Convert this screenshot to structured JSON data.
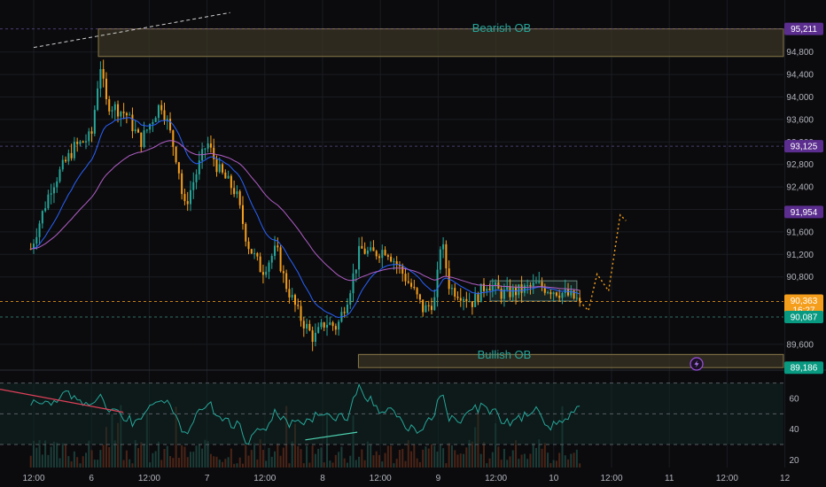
{
  "colors": {
    "background": "#0b0b0d",
    "grid": "#1a1c22",
    "up": "#26a69a",
    "down": "#f59e1c",
    "ma_fast": "#2962ff",
    "ma_slow": "#b05ec7",
    "ob_fill": "#3a3424",
    "ob_border": "#8a7a4a",
    "ob_text": "#26a69a",
    "tag_purple": "#5b2d8e",
    "tag_orange": "#f59e1c",
    "tag_green": "#089981",
    "rsi_line": "#26a69a",
    "volume": "#1f4a44"
  },
  "chart_data": [
    {
      "type": "candlestick",
      "ylim": [
        89000,
        95500
      ],
      "y_ticks": [
        "94,800",
        "94,400",
        "94,000",
        "93,600",
        "93,200",
        "92,800",
        "92,400",
        "92,000",
        "91,600",
        "91,200",
        "90,800",
        "89,600"
      ],
      "x_ticks": [
        "12:00",
        "6",
        "12:00",
        "7",
        "12:00",
        "8",
        "12:00",
        "9",
        "12:00",
        "10",
        "12:00",
        "11",
        "12:00",
        "12"
      ],
      "x_domain": [
        0,
        14
      ],
      "close_path": [
        [
          -0.05,
          91300
        ],
        [
          0.3,
          92400
        ],
        [
          0.7,
          93100
        ],
        [
          1.0,
          93300
        ],
        [
          1.15,
          94600
        ],
        [
          1.25,
          93900
        ],
        [
          1.6,
          93700
        ],
        [
          1.85,
          93200
        ],
        [
          2.05,
          93600
        ],
        [
          2.2,
          93900
        ],
        [
          2.3,
          93600
        ],
        [
          2.5,
          92800
        ],
        [
          2.6,
          92000
        ],
        [
          2.8,
          92600
        ],
        [
          3.0,
          93200
        ],
        [
          3.2,
          92700
        ],
        [
          3.5,
          92300
        ],
        [
          3.7,
          91400
        ],
        [
          3.95,
          90900
        ],
        [
          4.2,
          91300
        ],
        [
          4.35,
          90700
        ],
        [
          4.6,
          90100
        ],
        [
          4.85,
          89700
        ],
        [
          5.05,
          90000
        ],
        [
          5.25,
          89900
        ],
        [
          5.45,
          90500
        ],
        [
          5.65,
          91300
        ],
        [
          5.85,
          91200
        ],
        [
          6.1,
          91300
        ],
        [
          6.3,
          91000
        ],
        [
          6.55,
          90600
        ],
        [
          6.75,
          90200
        ],
        [
          6.95,
          90400
        ],
        [
          7.05,
          91500
        ],
        [
          7.2,
          90600
        ],
        [
          7.4,
          90500
        ],
        [
          7.6,
          90350
        ],
        [
          7.85,
          90700
        ],
        [
          8.1,
          90500
        ],
        [
          8.4,
          90550
        ],
        [
          8.7,
          90650
        ],
        [
          9.05,
          90550
        ],
        [
          9.3,
          90450
        ],
        [
          9.45,
          90363
        ]
      ],
      "candle_count": 190,
      "seed": 7
    },
    {
      "type": "line",
      "series": [
        {
          "name": "",
          "smoothing": "fast"
        },
        {
          "name": "",
          "smoothing": "slow"
        }
      ]
    },
    {
      "type": "line",
      "projection_path": [
        [
          9.45,
          90363
        ],
        [
          9.6,
          90200
        ],
        [
          9.75,
          90850
        ],
        [
          9.95,
          90550
        ],
        [
          10.15,
          91900
        ],
        [
          10.25,
          91800
        ]
      ]
    },
    {
      "type": "line",
      "ylim": [
        15,
        75
      ],
      "y_ticks": [
        "60",
        "40",
        "20"
      ],
      "bands": [
        70,
        50,
        30
      ],
      "seed": 11
    }
  ],
  "labels": {
    "bearish_ob": "Bearish OB",
    "bullish_ob": "Bullish OB"
  },
  "order_blocks": {
    "bearish": {
      "x0": 1.12,
      "x1": 14,
      "y_top": 95211,
      "y_bottom": 94720
    },
    "bullish": {
      "x0": 5.62,
      "x1": 14,
      "y_top": 89420,
      "y_bottom": 89186
    }
  },
  "range_box": {
    "x0": 7.9,
    "x1": 9.4,
    "y_top": 90730,
    "y_bottom": 90370
  },
  "price_tags": [
    {
      "value": "95,211",
      "price": 95211,
      "style": "purple",
      "line": true
    },
    {
      "value": "93,125",
      "price": 93125,
      "style": "purple",
      "line": true
    },
    {
      "value": "91,954",
      "price": 91954,
      "style": "purple",
      "line": false
    },
    {
      "value": "90,363",
      "sub": "16:27",
      "price": 90363,
      "style": "orange",
      "line": true
    },
    {
      "value": "90,087",
      "price": 90087,
      "style": "green",
      "line": true
    },
    {
      "value": "89,186",
      "price": 89186,
      "style": "green",
      "line": false
    }
  ],
  "trendlines": [
    {
      "x0": 0,
      "y0": 94880,
      "x1": 3.4,
      "y1": 95500,
      "style": "dashed-white"
    }
  ],
  "icon": "lightning-icon"
}
